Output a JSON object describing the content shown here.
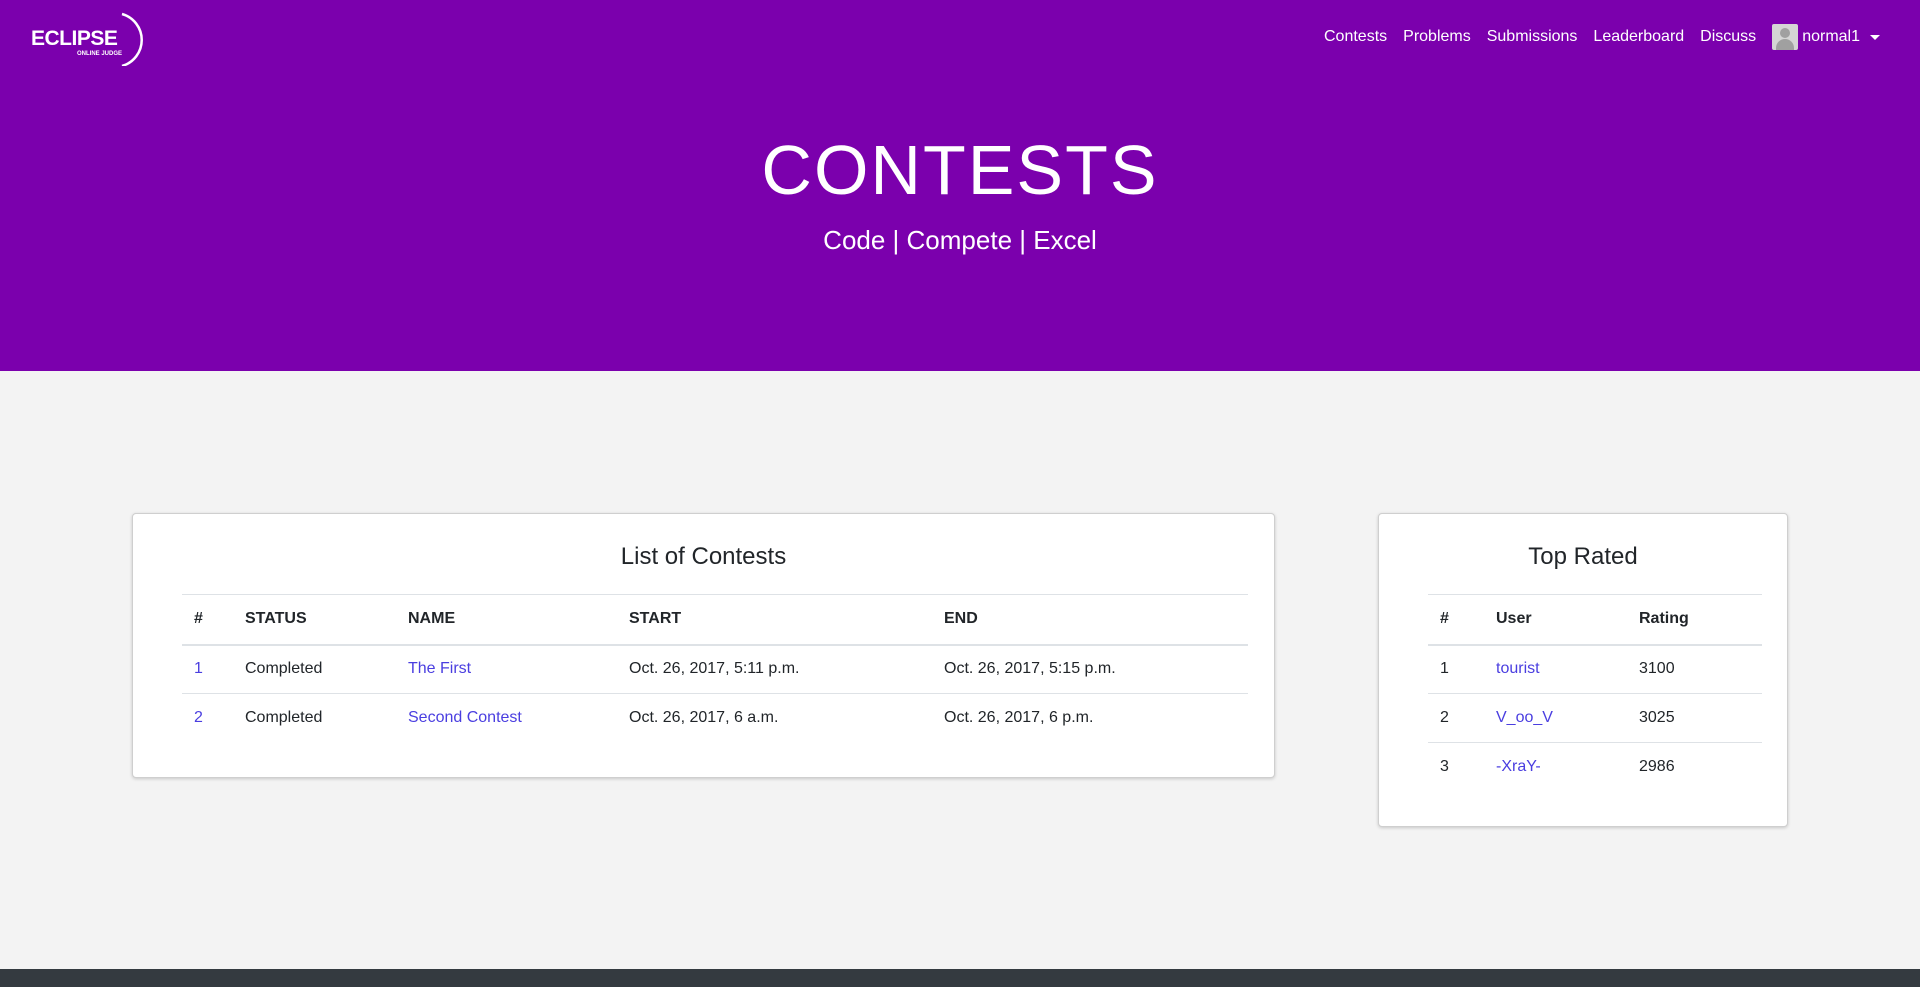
{
  "brand": {
    "name": "ECLIPSE",
    "subtitle": "ONLINE JUDGE"
  },
  "nav": {
    "items": [
      "Contests",
      "Problems",
      "Submissions",
      "Leaderboard",
      "Discuss"
    ],
    "user": "normal1"
  },
  "hero": {
    "title": "CONTESTS",
    "subtitle": "Code | Compete | Excel"
  },
  "contests": {
    "title": "List of Contests",
    "columns": [
      "#",
      "STATUS",
      "NAME",
      "START",
      "END"
    ],
    "rows": [
      {
        "id": "1",
        "status": "Completed",
        "name": "The First",
        "start": "Oct. 26, 2017, 5:11 p.m.",
        "end": "Oct. 26, 2017, 5:15 p.m."
      },
      {
        "id": "2",
        "status": "Completed",
        "name": "Second Contest",
        "start": "Oct. 26, 2017, 6 a.m.",
        "end": "Oct. 26, 2017, 6 p.m."
      }
    ]
  },
  "top_rated": {
    "title": "Top Rated",
    "columns": [
      "#",
      "User",
      "Rating"
    ],
    "rows": [
      {
        "rank": "1",
        "user": "tourist",
        "rating": "3100"
      },
      {
        "rank": "2",
        "user": "V_oo_V",
        "rating": "3025"
      },
      {
        "rank": "3",
        "user": "-XraY-",
        "rating": "2986"
      }
    ]
  },
  "colors": {
    "header_bg": "#7b00ad",
    "link": "#4a3ee0",
    "page_bg": "#f3f3f3",
    "footer": "#343a40"
  }
}
